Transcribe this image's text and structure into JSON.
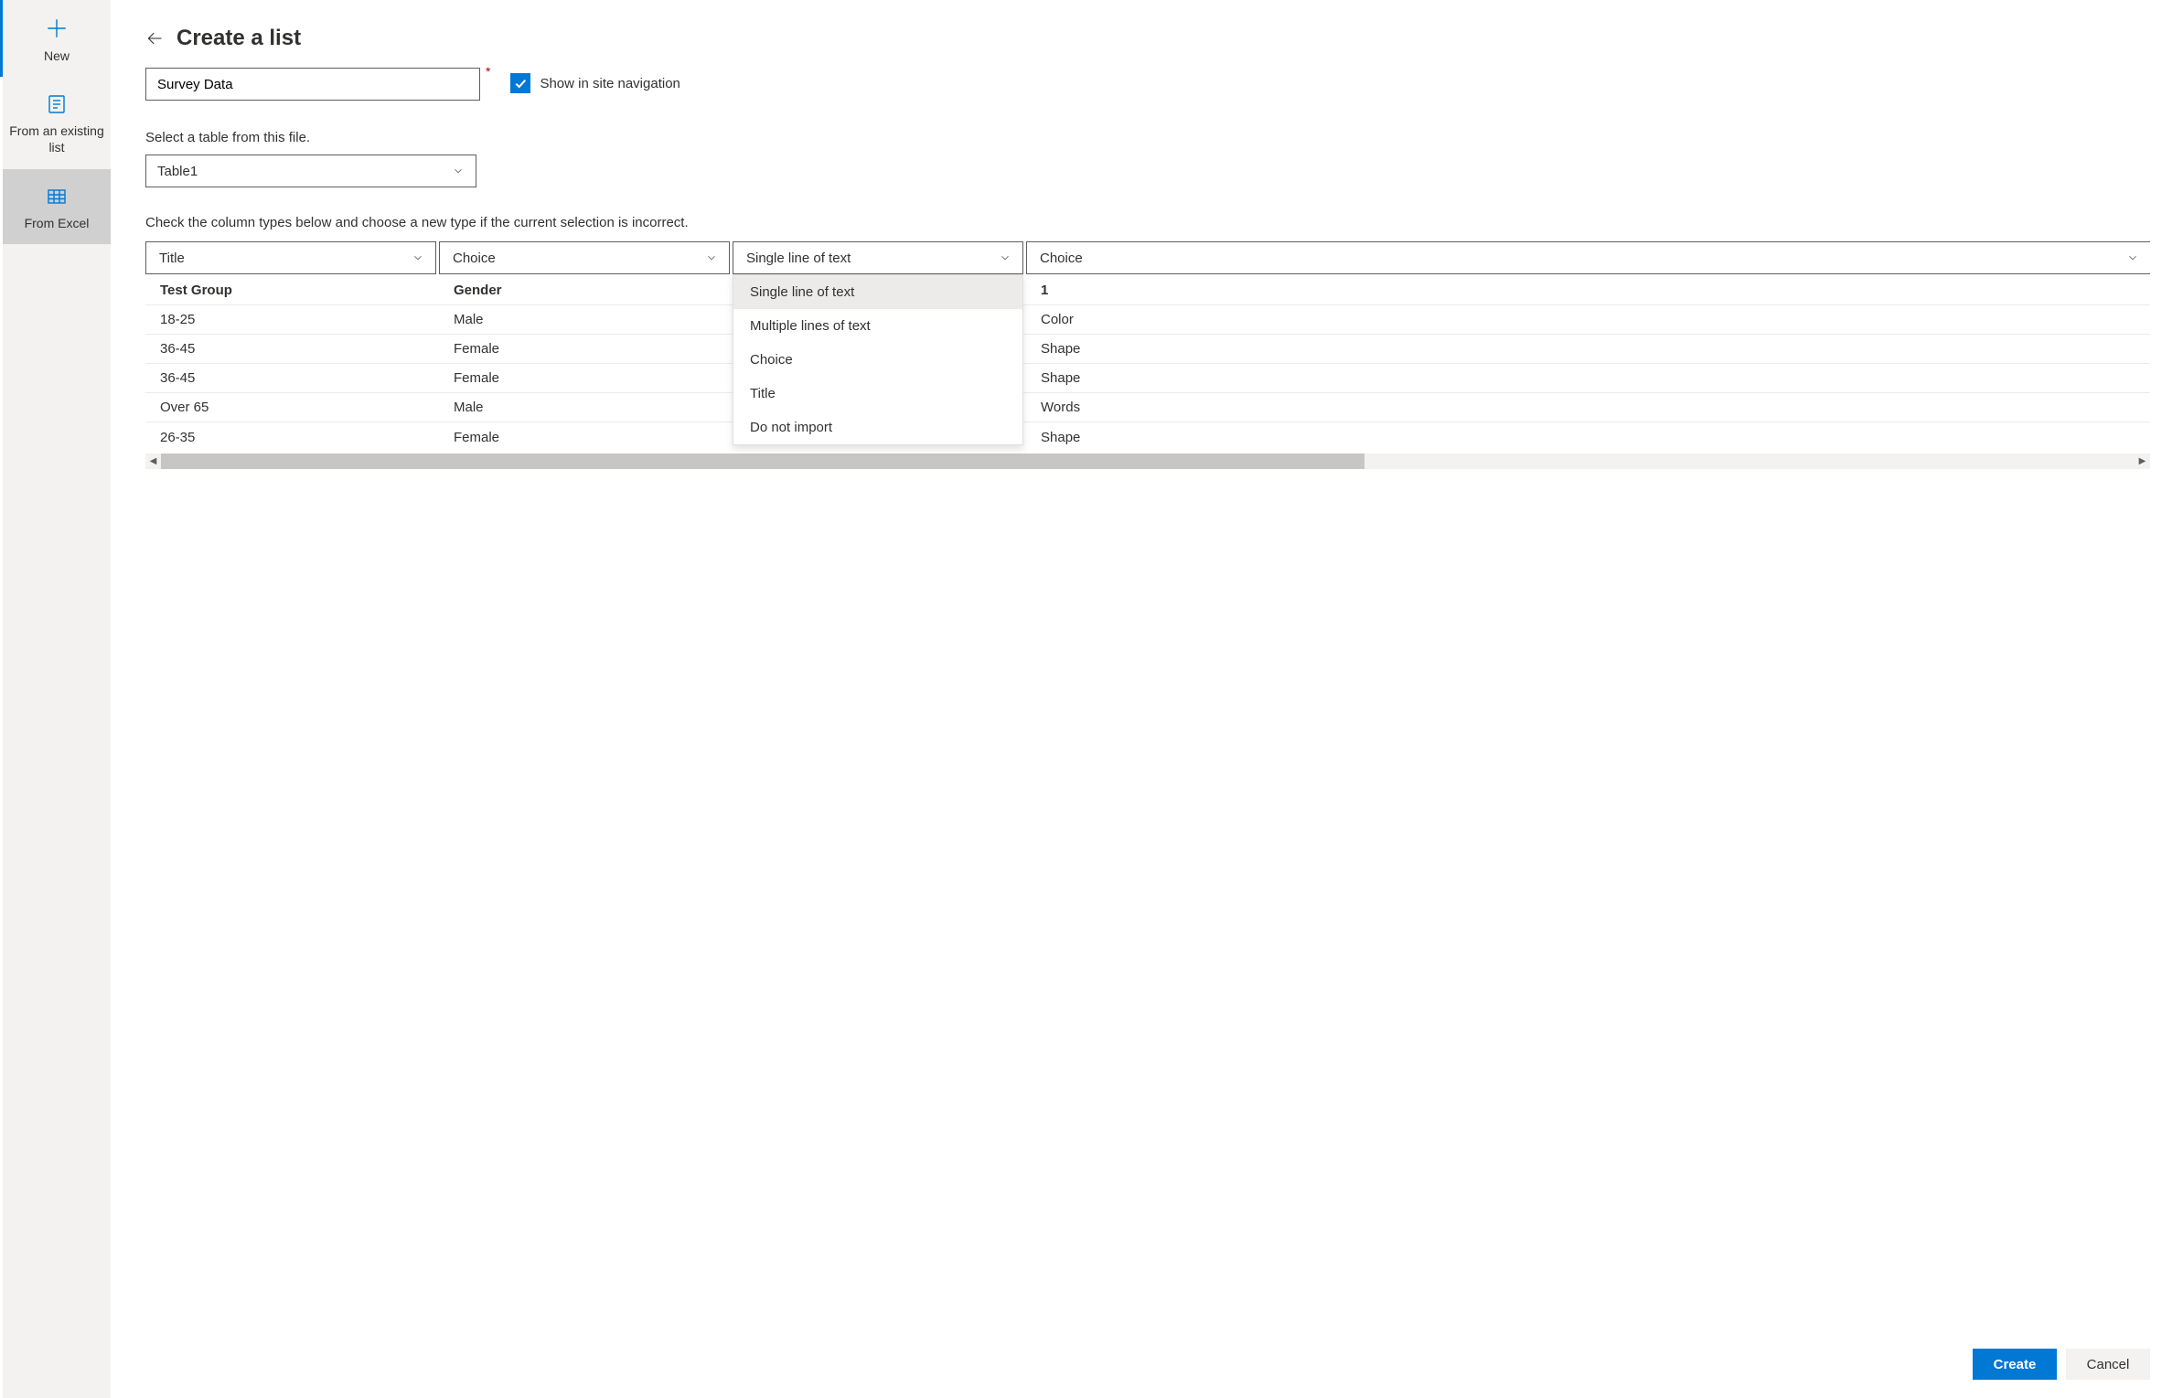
{
  "sidebar": {
    "items": [
      {
        "label": "New"
      },
      {
        "label": "From an existing list"
      },
      {
        "label": "From Excel"
      }
    ]
  },
  "header": {
    "title": "Create a list"
  },
  "form": {
    "name_value": "Survey Data",
    "show_nav_label": "Show in site navigation",
    "table_label": "Select a table from this file.",
    "table_value": "Table1",
    "instruction": "Check the column types below and choose a new type if the current selection is incorrect."
  },
  "columns": [
    {
      "type": "Title",
      "header": "Test Group",
      "cells": [
        "18-25",
        "36-45",
        "36-45",
        "Over 65",
        "26-35"
      ]
    },
    {
      "type": "Choice",
      "header": "Gender",
      "cells": [
        "Male",
        "Female",
        "Female",
        "Male",
        "Female"
      ]
    },
    {
      "type": "Single line of text",
      "header": "",
      "cells": [
        "",
        "",
        "",
        "",
        ""
      ]
    },
    {
      "type": "Choice",
      "header": "1",
      "cells": [
        "Color",
        "Shape",
        "Shape",
        "Words",
        "Shape"
      ]
    }
  ],
  "dropdown": {
    "options": [
      "Single line of text",
      "Multiple lines of text",
      "Choice",
      "Title",
      "Do not import"
    ],
    "selected": "Single line of text"
  },
  "footer": {
    "create": "Create",
    "cancel": "Cancel"
  }
}
